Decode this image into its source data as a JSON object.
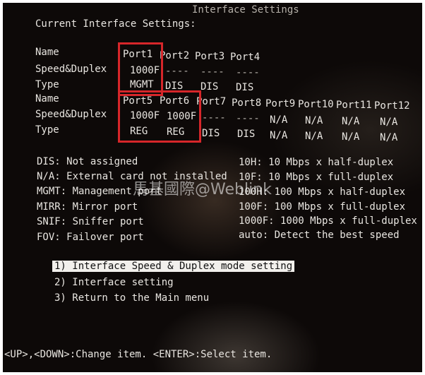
{
  "window_title": "Interface Settings",
  "section_title": "Current Interface Settings:",
  "labels": {
    "name": "Name",
    "speed_duplex": "Speed&Duplex",
    "type": "Type"
  },
  "group1": {
    "names": [
      "Port1",
      "Port2",
      "Port3",
      "Port4"
    ],
    "speeds": [
      "1000F",
      "----",
      "----",
      "----"
    ],
    "types": [
      "MGMT",
      "DIS",
      "DIS",
      "DIS"
    ]
  },
  "group2": {
    "names": [
      "Port5",
      "Port6",
      "Port7",
      "Port8",
      "Port9",
      "Port10",
      "Port11",
      "Port12"
    ],
    "speeds": [
      "1000F",
      "1000F",
      "----",
      "----",
      "N/A",
      "N/A",
      "N/A",
      "N/A"
    ],
    "types": [
      "REG",
      "REG",
      "DIS",
      "DIS",
      "N/A",
      "N/A",
      "N/A",
      "N/A"
    ]
  },
  "legend_left": [
    "DIS: Not assigned",
    "N/A: External card not installed",
    "MGMT: Management port",
    "MIRR: Mirror port",
    "SNIF: Sniffer port",
    "FOV: Failover port"
  ],
  "legend_right": [
    "10H: 10 Mbps x half-duplex",
    "10F: 10 Mbps x full-duplex",
    "100H: 100 Mbps x half-duplex",
    "100F: 100 Mbps x full-duplex",
    "1000F: 1000 Mbps x full-duplex",
    "auto: Detect the best speed"
  ],
  "menu": [
    "1) Interface Speed & Duplex mode setting",
    "2) Interface setting",
    "3) Return to the Main menu"
  ],
  "selected_menu_index": 0,
  "footer": "<UP>,<DOWN>:Change item. <ENTER>:Select item.",
  "watermark": "馬基國際@Weblink",
  "colors": {
    "screen_bg": "#0d0908",
    "text": "#e9e6e1",
    "highlight_box": "#d6262a",
    "selection_bg": "#f2f0ec"
  }
}
